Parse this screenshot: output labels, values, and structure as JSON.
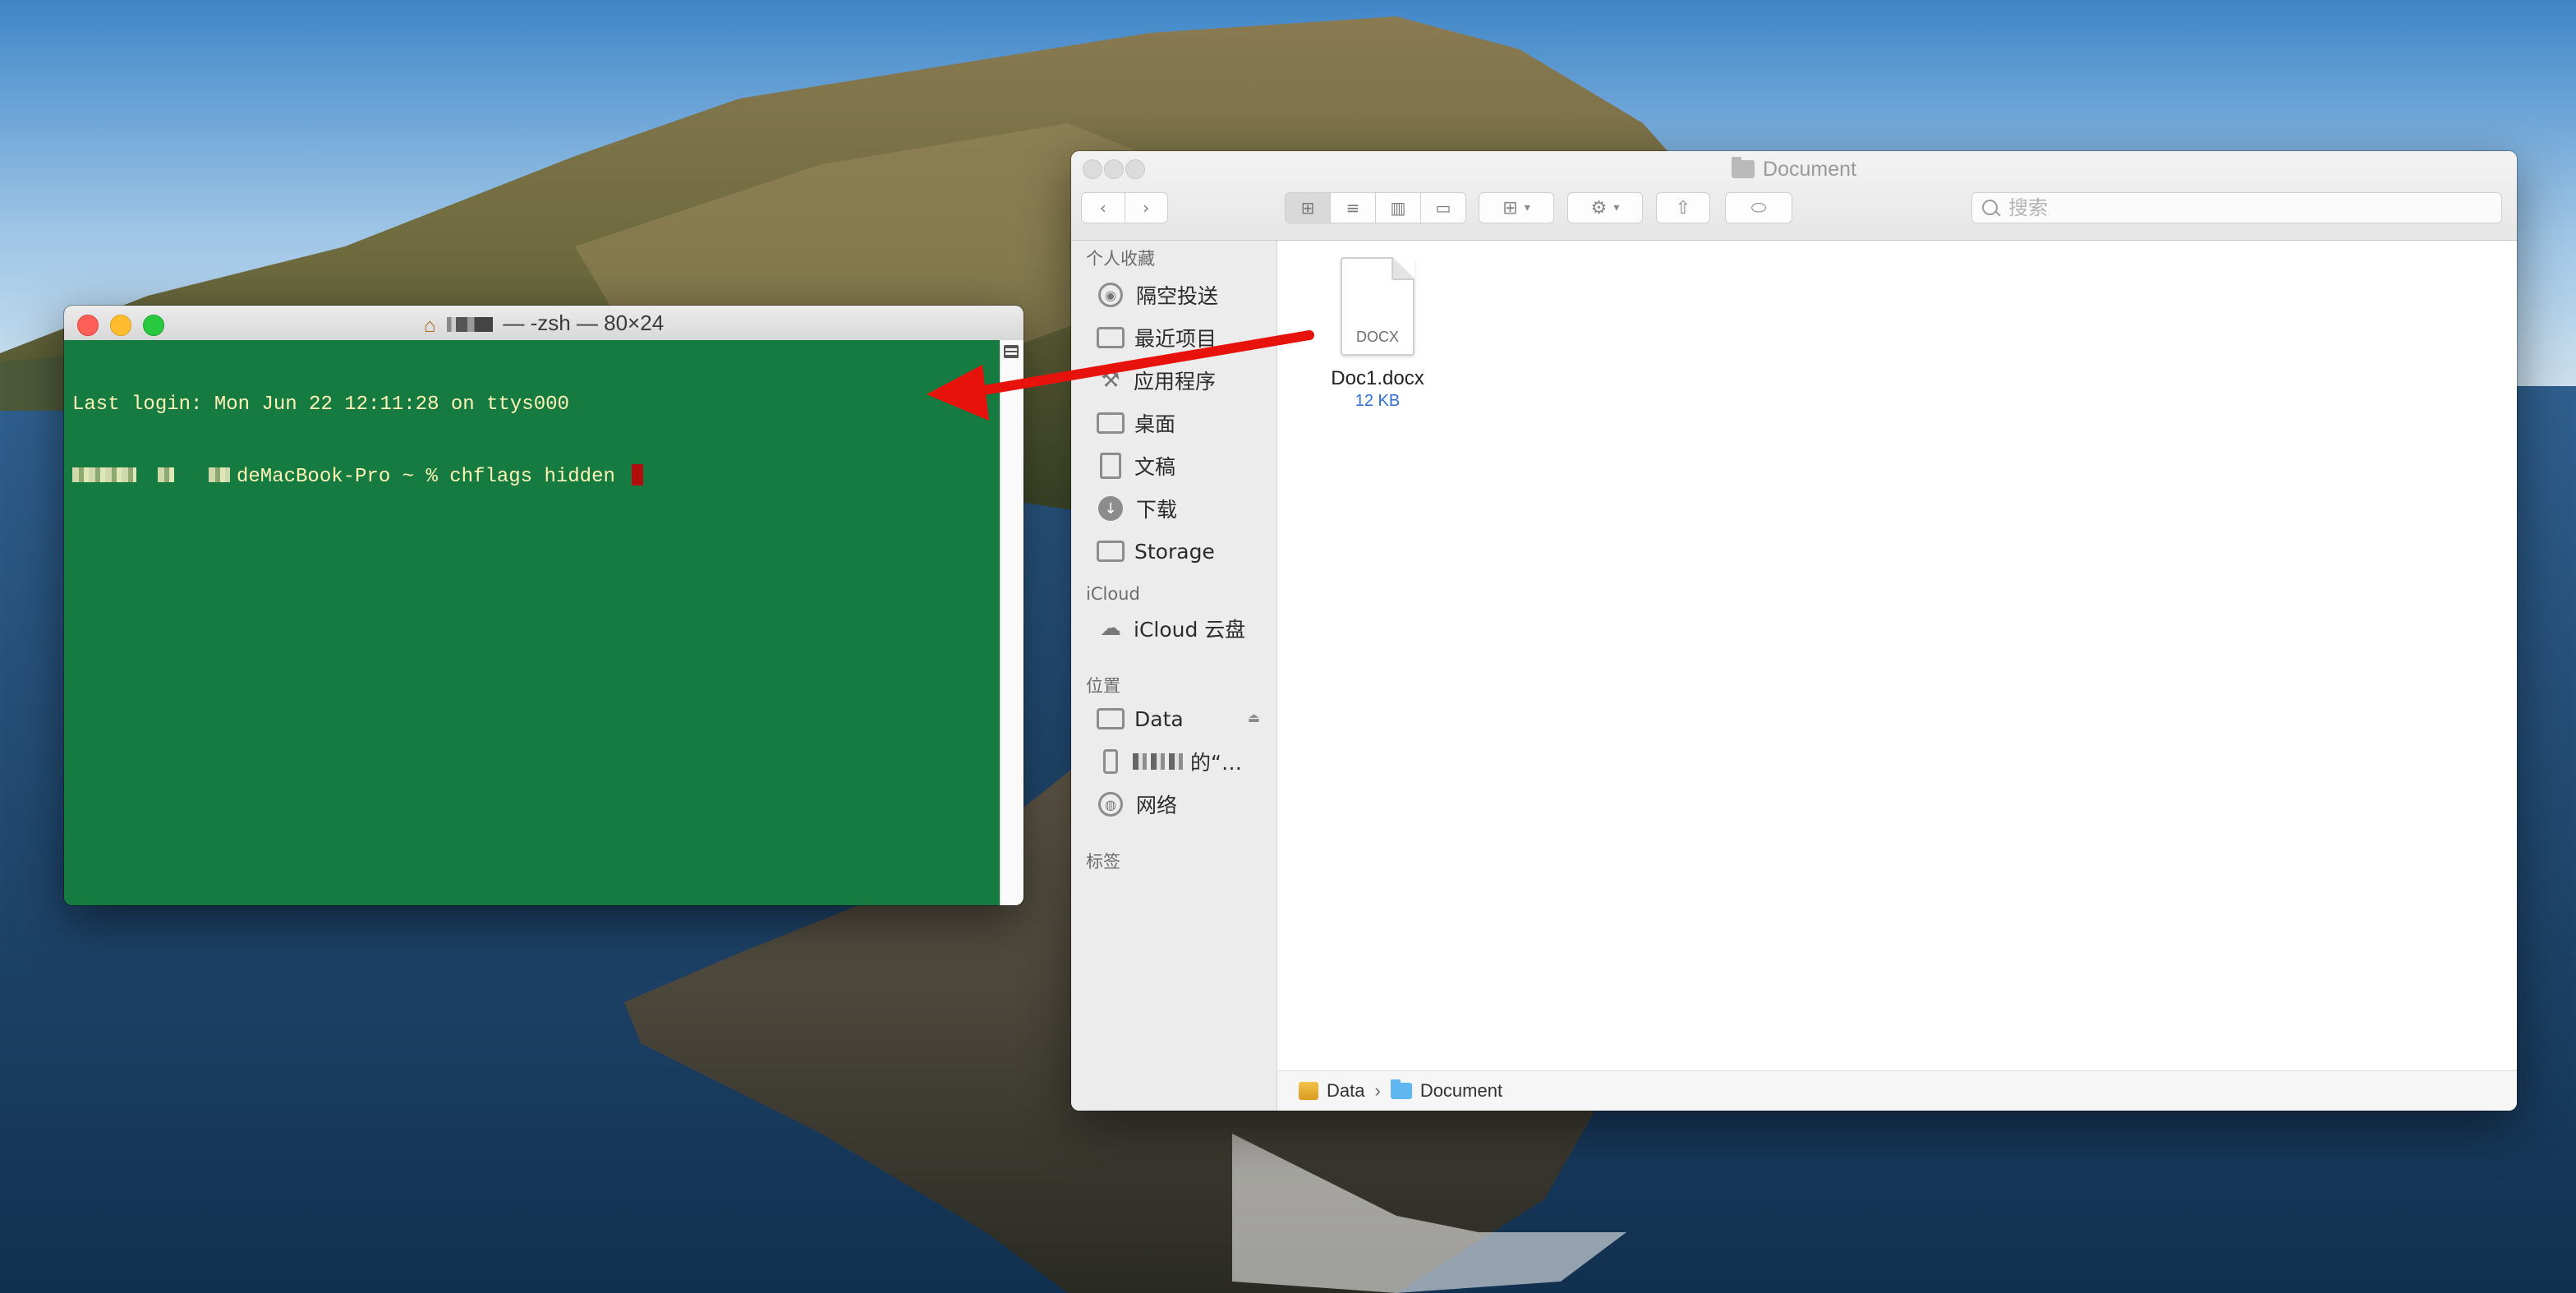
{
  "terminal": {
    "title": "— -zsh — 80×24",
    "line1": "Last login: Mon Jun 22 12:11:28 on ttys000",
    "line2_host": "deMacBook-Pro ~ % chflags hidden ",
    "colors": {
      "background": "#157b40",
      "text": "#fff4b8",
      "cursor": "#b10d0d"
    }
  },
  "finder": {
    "title": "Document",
    "search_placeholder": "搜索",
    "sidebar": {
      "favorites_header": "个人收藏",
      "favorites": [
        {
          "label": "隔空投送",
          "icon": "airdrop-icon"
        },
        {
          "label": "最近项目",
          "icon": "recents-icon"
        },
        {
          "label": "应用程序",
          "icon": "applications-icon"
        },
        {
          "label": "桌面",
          "icon": "desktop-icon"
        },
        {
          "label": "文稿",
          "icon": "documents-icon"
        },
        {
          "label": "下载",
          "icon": "downloads-icon"
        },
        {
          "label": "Storage",
          "icon": "folder-icon"
        }
      ],
      "icloud_header": "iCloud",
      "icloud_items": [
        {
          "label": "iCloud 云盘",
          "icon": "cloud-icon"
        }
      ],
      "locations_header": "位置",
      "locations": [
        {
          "label": "Data",
          "icon": "disk-icon"
        },
        {
          "label": "的“…",
          "icon": "iphone-icon"
        },
        {
          "label": "网络",
          "icon": "network-icon"
        }
      ],
      "tags_header": "标签"
    },
    "files": [
      {
        "name": "Doc1.docx",
        "size": "12 KB",
        "ext": "DOCX"
      }
    ],
    "pathbar": [
      "Data",
      "Document"
    ],
    "accent_color": "#2f6fd3"
  },
  "annotation": {
    "arrow_color": "#e8120c"
  }
}
